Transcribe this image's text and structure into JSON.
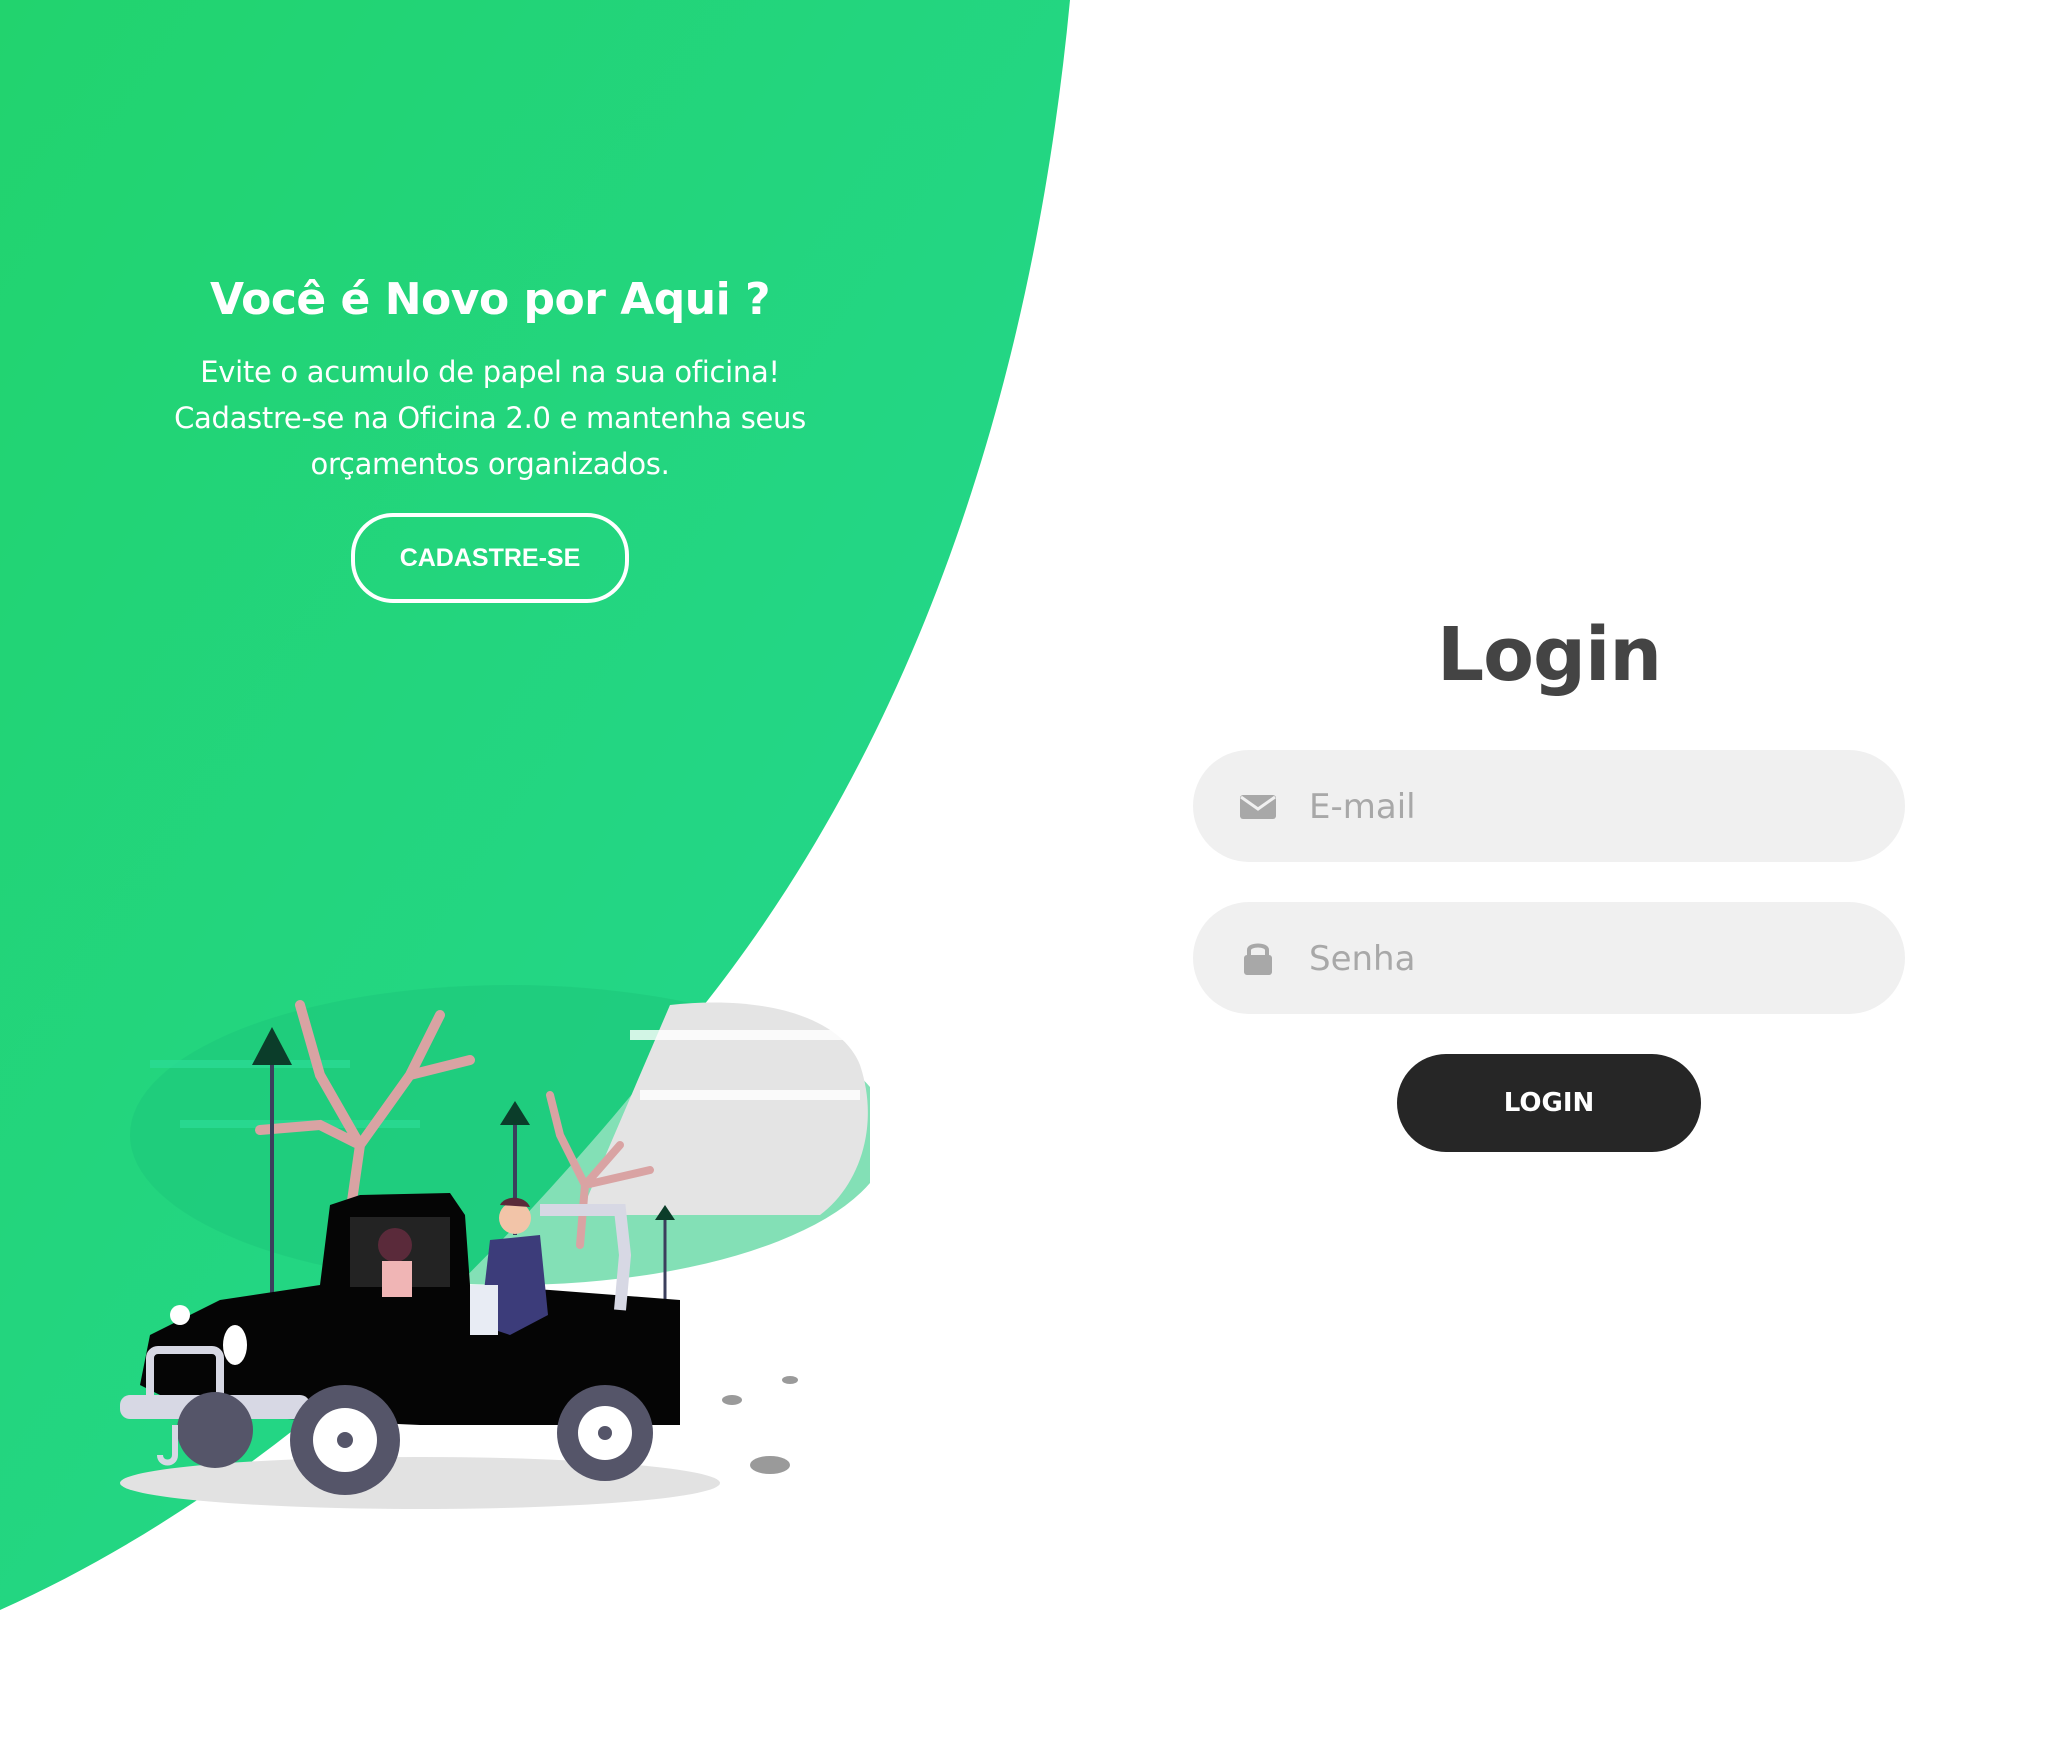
{
  "welcome": {
    "title": "Você é Novo por Aqui ?",
    "description_line1": "Evite o acumulo de papel na sua oficina!",
    "description_line2": "Cadastre-se na Oficina 2.0 e mantenha seus",
    "description_line3": "orçamentos organizados.",
    "signup_label": "CADASTRE-SE"
  },
  "login": {
    "title": "Login",
    "email": {
      "placeholder": "E-mail",
      "value": "",
      "icon": "envelope-icon"
    },
    "password": {
      "placeholder": "Senha",
      "value": "",
      "icon": "lock-icon"
    },
    "submit_label": "LOGIN"
  },
  "colors": {
    "green_start": "#22d36e",
    "green_end": "#24d894",
    "dark_button": "#262626",
    "input_bg": "#f0f0f0",
    "title_text": "#444444",
    "placeholder": "#a8a8a8"
  },
  "illustration": {
    "subject": "couple-in-jeep-illustration"
  }
}
